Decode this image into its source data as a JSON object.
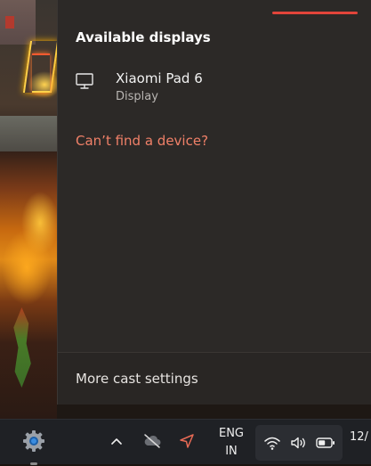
{
  "flyout": {
    "section_title": "Available displays",
    "devices": [
      {
        "name": "Xiaomi Pad 6",
        "type": "Display",
        "icon": "monitor-icon"
      }
    ],
    "cant_find_link": "Can’t find a device?",
    "footer_link": "More cast settings",
    "accent_color": "#e2443a",
    "link_color": "#f08068"
  },
  "taskbar": {
    "pinned": [
      {
        "name": "Settings",
        "icon": "gear-icon"
      }
    ],
    "tray_icons": [
      "chevron-up-icon",
      "cloud-off-icon",
      "location-arrow-icon"
    ],
    "language": {
      "line1": "ENG",
      "line2": "IN"
    },
    "quick_settings_icons": [
      "wifi-icon",
      "volume-icon",
      "battery-icon"
    ],
    "clock_text": "12/"
  }
}
